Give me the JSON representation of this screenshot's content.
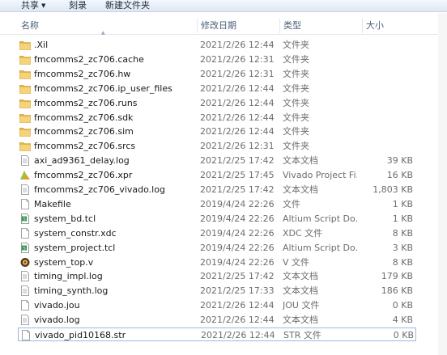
{
  "toolbar": {
    "share": "共享",
    "burn": "刻录",
    "new_folder": "新建文件夹"
  },
  "columns": {
    "name": "名称",
    "date": "修改日期",
    "type": "类型",
    "size": "大小"
  },
  "files": [
    {
      "name": ".Xil",
      "date": "2021/2/26 12:44",
      "type": "文件夹",
      "size": "",
      "icon": "folder-icon"
    },
    {
      "name": "fmcomms2_zc706.cache",
      "date": "2021/2/26 12:31",
      "type": "文件夹",
      "size": "",
      "icon": "folder-icon"
    },
    {
      "name": "fmcomms2_zc706.hw",
      "date": "2021/2/26 12:31",
      "type": "文件夹",
      "size": "",
      "icon": "folder-icon"
    },
    {
      "name": "fmcomms2_zc706.ip_user_files",
      "date": "2021/2/26 12:44",
      "type": "文件夹",
      "size": "",
      "icon": "folder-icon"
    },
    {
      "name": "fmcomms2_zc706.runs",
      "date": "2021/2/26 12:44",
      "type": "文件夹",
      "size": "",
      "icon": "folder-icon"
    },
    {
      "name": "fmcomms2_zc706.sdk",
      "date": "2021/2/26 12:44",
      "type": "文件夹",
      "size": "",
      "icon": "folder-icon"
    },
    {
      "name": "fmcomms2_zc706.sim",
      "date": "2021/2/26 12:44",
      "type": "文件夹",
      "size": "",
      "icon": "folder-icon"
    },
    {
      "name": "fmcomms2_zc706.srcs",
      "date": "2021/2/26 12:31",
      "type": "文件夹",
      "size": "",
      "icon": "folder-icon"
    },
    {
      "name": "axi_ad9361_delay.log",
      "date": "2021/2/25 17:42",
      "type": "文本文档",
      "size": "39 KB",
      "icon": "text-file-icon"
    },
    {
      "name": "fmcomms2_zc706.xpr",
      "date": "2021/2/25 17:45",
      "type": "Vivado Project Fi...",
      "size": "16 KB",
      "icon": "vivado-project-icon"
    },
    {
      "name": "fmcomms2_zc706_vivado.log",
      "date": "2021/2/25 17:42",
      "type": "文本文档",
      "size": "1,803 KB",
      "icon": "text-file-icon"
    },
    {
      "name": "Makefile",
      "date": "2019/4/24 22:26",
      "type": "文件",
      "size": "1 KB",
      "icon": "blank-file-icon"
    },
    {
      "name": "system_bd.tcl",
      "date": "2019/4/24 22:26",
      "type": "Altium Script Do...",
      "size": "1 KB",
      "icon": "script-file-icon"
    },
    {
      "name": "system_constr.xdc",
      "date": "2019/4/24 22:26",
      "type": "XDC 文件",
      "size": "8 KB",
      "icon": "blank-file-icon"
    },
    {
      "name": "system_project.tcl",
      "date": "2019/4/24 22:26",
      "type": "Altium Script Do...",
      "size": "3 KB",
      "icon": "script-file-icon"
    },
    {
      "name": "system_top.v",
      "date": "2019/4/24 22:26",
      "type": "V 文件",
      "size": "8 KB",
      "icon": "verilog-file-icon"
    },
    {
      "name": "timing_impl.log",
      "date": "2021/2/25 17:42",
      "type": "文本文档",
      "size": "179 KB",
      "icon": "text-file-icon"
    },
    {
      "name": "timing_synth.log",
      "date": "2021/2/25 17:33",
      "type": "文本文档",
      "size": "186 KB",
      "icon": "text-file-icon"
    },
    {
      "name": "vivado.jou",
      "date": "2021/2/26 12:44",
      "type": "JOU 文件",
      "size": "0 KB",
      "icon": "blank-file-icon"
    },
    {
      "name": "vivado.log",
      "date": "2021/2/26 12:44",
      "type": "文本文档",
      "size": "4 KB",
      "icon": "text-file-icon"
    },
    {
      "name": "vivado_pid10168.str",
      "date": "2021/2/26 12:44",
      "type": "STR 文件",
      "size": "0 KB",
      "icon": "blank-file-icon",
      "selected": true
    }
  ]
}
